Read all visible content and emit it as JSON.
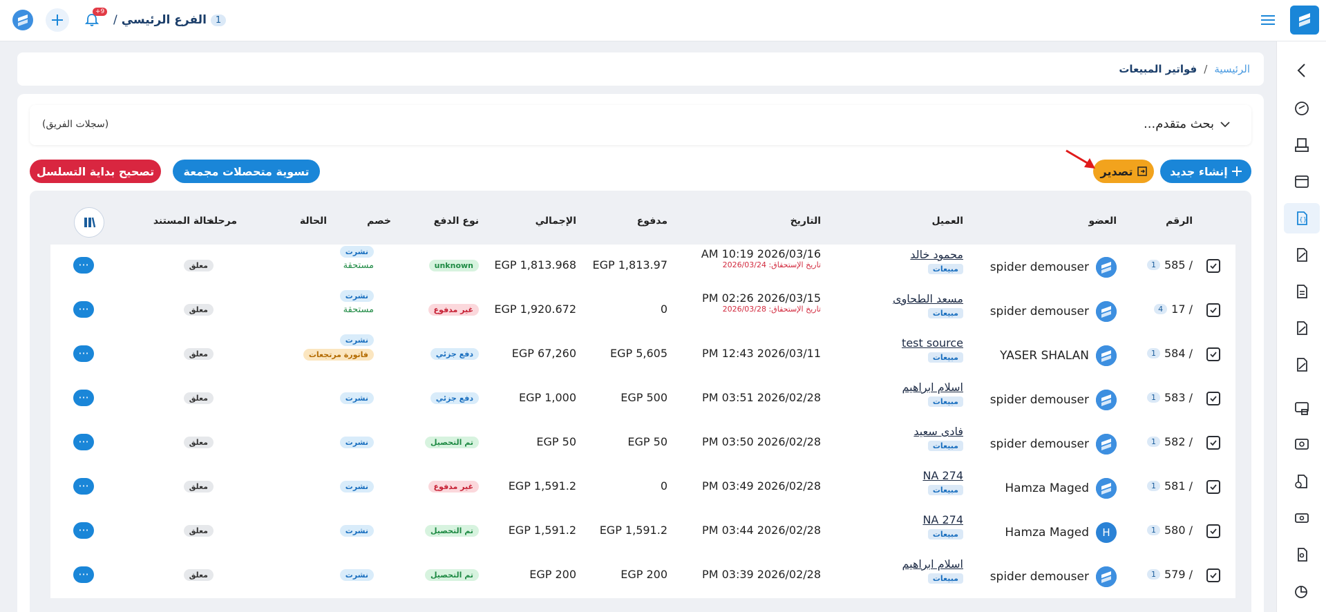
{
  "topbar": {
    "branch_number": "1",
    "branch_name": "الفرع الرئيسي",
    "branch_sep": "/",
    "notifications_badge": "+9"
  },
  "breadcrumb": {
    "home": "الرئيسية",
    "sep": "/",
    "current": "فواتير المبيعات"
  },
  "search": {
    "title": "بحث متقدم...",
    "team_records": "(سجلات الفريق)"
  },
  "toolbar": {
    "new_label": "إنشاء جديد",
    "export_label": "تصدير",
    "settle_label": "تسوية متحصلات مجمعة",
    "fix_label": "تصحيح بداية التسلسل"
  },
  "table": {
    "headers": {
      "number": "الرقم",
      "member": "العضو",
      "customer": "العميل",
      "date": "التاريخ",
      "paid": "مدفوع",
      "total": "الإجمالي",
      "paytype": "نوع الدفع",
      "discount": "خصم",
      "state": "الحالة",
      "stage": "مرحلة",
      "docstate": "حالة المستند"
    },
    "rows": [
      {
        "num": "585 /",
        "badge": "1",
        "member": "spider demouser",
        "avatar": "",
        "customer": "محمود خالد",
        "tag": "مبيعات",
        "date": "AM 10:19 2026/03/16",
        "due": "تاريخ الإستحقاق: 2026/03/24",
        "paid": "EGP 1,813.97",
        "total": "EGP 1,813.968",
        "paytype": "unknown",
        "paytype_style": "green",
        "state": "نشرت",
        "state2": "مستحقة",
        "state2_style": "text",
        "docstate": "معلق"
      },
      {
        "num": "17 /",
        "badge": "4",
        "member": "spider demouser",
        "avatar": "",
        "customer": "مسعد الطحاوى",
        "tag": "مبيعات",
        "date": "PM 02:26 2026/03/15",
        "due": "تاريخ الإستحقاق: 2026/03/28",
        "paid": "0",
        "total": "EGP 1,920.672",
        "paytype": "غير مدفوع",
        "paytype_style": "red",
        "state": "نشرت",
        "state2": "مستحقة",
        "state2_style": "text",
        "docstate": "معلق"
      },
      {
        "num": "584 /",
        "badge": "1",
        "member": "YASER SHALAN",
        "avatar": "",
        "customer": "test source",
        "tag": "مبيعات",
        "date": "PM 12:43 2026/03/11",
        "due": "",
        "paid": "EGP 5,605",
        "total": "EGP 67,260",
        "paytype": "دفع جزئي",
        "paytype_style": "blue",
        "state": "نشرت",
        "state2": "فاتورة مرتجعات",
        "state2_style": "orange",
        "docstate": "معلق"
      },
      {
        "num": "583 /",
        "badge": "1",
        "member": "spider demouser",
        "avatar": "",
        "customer": "اسلام ابراهيم",
        "tag": "مبيعات",
        "date": "PM 03:51 2026/02/28",
        "due": "",
        "paid": "EGP 500",
        "total": "EGP 1,000",
        "paytype": "دفع جزئي",
        "paytype_style": "blue",
        "state": "نشرت",
        "state2": "",
        "state2_style": "",
        "docstate": "معلق"
      },
      {
        "num": "582 /",
        "badge": "1",
        "member": "spider demouser",
        "avatar": "",
        "customer": "فادى سعيد",
        "tag": "مبيعات",
        "date": "PM 03:50 2026/02/28",
        "due": "",
        "paid": "EGP 50",
        "total": "EGP 50",
        "paytype": "تم التحصيل",
        "paytype_style": "green",
        "state": "نشرت",
        "state2": "",
        "state2_style": "",
        "docstate": "معلق"
      },
      {
        "num": "581 /",
        "badge": "1",
        "member": "Hamza Maged",
        "avatar": "",
        "customer": "NA 274",
        "tag": "مبيعات",
        "date": "PM 03:49 2026/02/28",
        "due": "",
        "paid": "0",
        "total": "EGP 1,591.2",
        "paytype": "غير مدفوع",
        "paytype_style": "red",
        "state": "نشرت",
        "state2": "",
        "state2_style": "",
        "docstate": "معلق"
      },
      {
        "num": "580 /",
        "badge": "1",
        "member": "Hamza Maged",
        "avatar": "H",
        "customer": "NA 274",
        "tag": "مبيعات",
        "date": "PM 03:44 2026/02/28",
        "due": "",
        "paid": "EGP 1,591.2",
        "total": "EGP 1,591.2",
        "paytype": "تم التحصيل",
        "paytype_style": "green",
        "state": "نشرت",
        "state2": "",
        "state2_style": "",
        "docstate": "معلق"
      },
      {
        "num": "579 /",
        "badge": "1",
        "member": "spider demouser",
        "avatar": "",
        "customer": "اسلام ابراهيم",
        "tag": "مبيعات",
        "date": "PM 03:39 2026/02/28",
        "due": "",
        "paid": "EGP 200",
        "total": "EGP 200",
        "paytype": "تم التحصيل",
        "paytype_style": "green",
        "state": "نشرت",
        "state2": "",
        "state2_style": "",
        "docstate": "معلق"
      }
    ],
    "more_label": "···"
  },
  "colors": {
    "primary": "#1a86d8",
    "export": "#f2a31d",
    "danger": "#d92640"
  }
}
